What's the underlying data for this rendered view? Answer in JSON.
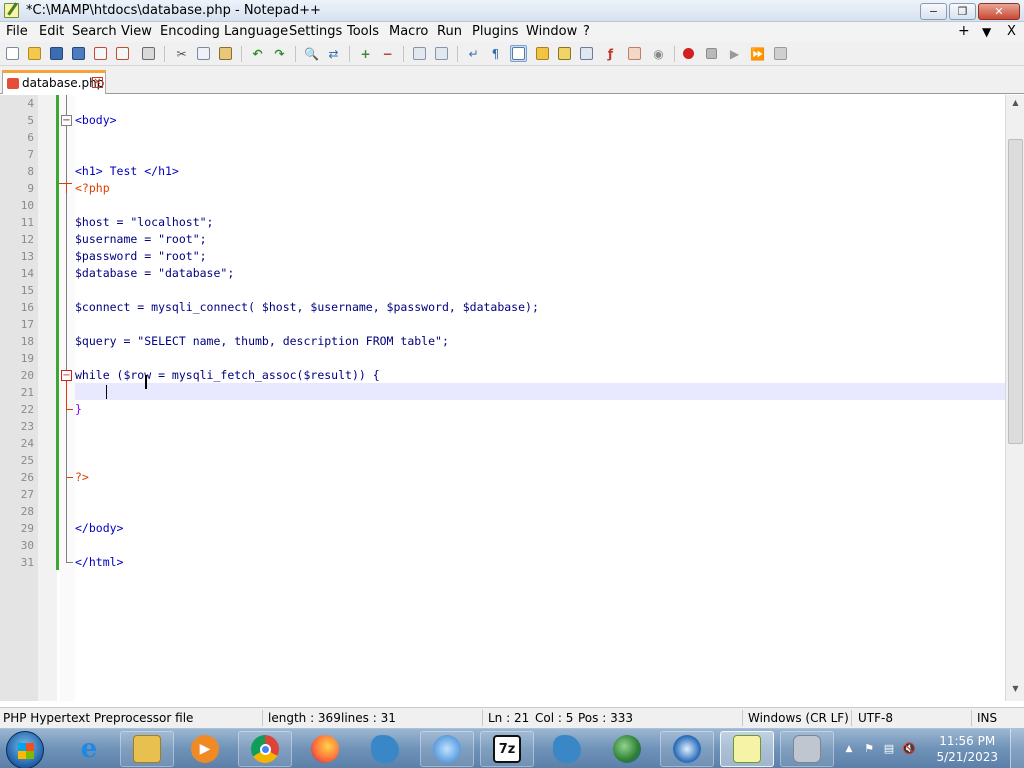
{
  "window": {
    "title": "*C:\\MAMP\\htdocs\\database.php - Notepad++",
    "controls": {
      "minimize": "−",
      "maximize": "❐",
      "close": "✕"
    }
  },
  "menu": {
    "items": [
      "File",
      "Edit",
      "Search",
      "View",
      "Encoding",
      "Language",
      "Settings",
      "Tools",
      "Macro",
      "Run",
      "Plugins",
      "Window",
      "?"
    ],
    "right": {
      "add": "+",
      "dropdown": "▼",
      "close": "X"
    }
  },
  "toolbar": {
    "icons": [
      "new-file",
      "open-file",
      "save",
      "save-all",
      "close",
      "close-all",
      "print",
      "cut",
      "copy",
      "paste",
      "undo",
      "redo",
      "find",
      "replace",
      "zoom-in",
      "zoom-out",
      "sync-vertical",
      "sync-horizontal",
      "word-wrap",
      "show-all-chars",
      "indent-guide",
      "user-defined-language",
      "document-map",
      "function-list",
      "folder-as-workspace",
      "monitoring",
      "record-macro",
      "stop-recording",
      "playback-macro",
      "run-macro-multiple",
      "save-macro"
    ]
  },
  "tab": {
    "label": "database.php",
    "close": "✕"
  },
  "editor": {
    "lines": [
      {
        "n": "4",
        "t": ""
      },
      {
        "n": "5",
        "t": "<body>"
      },
      {
        "n": "6",
        "t": ""
      },
      {
        "n": "7",
        "t": ""
      },
      {
        "n": "8",
        "t": "<h1> Test </h1>"
      },
      {
        "n": "9",
        "t": "<?php"
      },
      {
        "n": "10",
        "t": ""
      },
      {
        "n": "11",
        "t": "$host = \"localhost\";"
      },
      {
        "n": "12",
        "t": "$username = \"root\";"
      },
      {
        "n": "13",
        "t": "$password = \"root\";"
      },
      {
        "n": "14",
        "t": "$database = \"database\";"
      },
      {
        "n": "15",
        "t": ""
      },
      {
        "n": "16",
        "t": "$connect = mysqli_connect( $host, $username, $password, $database);"
      },
      {
        "n": "17",
        "t": ""
      },
      {
        "n": "18",
        "t": "$query = \"SELECT name, thumb, description FROM table\";"
      },
      {
        "n": "19",
        "t": ""
      },
      {
        "n": "20",
        "t": "while ($row = mysqli_fetch_assoc($result)) {"
      },
      {
        "n": "21",
        "t": ""
      },
      {
        "n": "22",
        "t": "}"
      },
      {
        "n": "23",
        "t": ""
      },
      {
        "n": "24",
        "t": ""
      },
      {
        "n": "25",
        "t": ""
      },
      {
        "n": "26",
        "t": "?>"
      },
      {
        "n": "27",
        "t": ""
      },
      {
        "n": "28",
        "t": ""
      },
      {
        "n": "29",
        "t": "</body>"
      },
      {
        "n": "30",
        "t": ""
      },
      {
        "n": "31",
        "t": "</html>"
      }
    ],
    "current_line": "21"
  },
  "status": {
    "file_type": "PHP Hypertext Preprocessor file",
    "length": "length : 369",
    "lines": "lines : 31",
    "ln": "Ln : 21",
    "col": "Col : 5",
    "pos": "Pos : 333",
    "eol": "Windows (CR LF)",
    "encoding": "UTF-8",
    "mode": "INS"
  },
  "taskbar": {
    "apps": [
      {
        "name": "internet-explorer",
        "glyph": "e",
        "color": "#1e88e5"
      },
      {
        "name": "file-explorer",
        "glyph": "",
        "color": "#e8c050"
      },
      {
        "name": "media-player",
        "glyph": "▶",
        "color": "#f08a24"
      },
      {
        "name": "chrome",
        "glyph": "",
        "color": "#4285f4"
      },
      {
        "name": "firefox",
        "glyph": "",
        "color": "#ff7139"
      },
      {
        "name": "mysql-workbench",
        "glyph": "",
        "color": "#3a87c8"
      },
      {
        "name": "network-tool",
        "glyph": "",
        "color": "#2f7fd0"
      },
      {
        "name": "7zip",
        "glyph": "7z",
        "color": "#111111"
      },
      {
        "name": "mysql",
        "glyph": "",
        "color": "#3a87c8"
      },
      {
        "name": "globe-app",
        "glyph": "",
        "color": "#4caf50"
      },
      {
        "name": "thunderbird",
        "glyph": "",
        "color": "#2a6ebb"
      },
      {
        "name": "notepad-plus-plus",
        "glyph": "",
        "color": "#8bc34a"
      },
      {
        "name": "mamp",
        "glyph": "",
        "color": "#c0c6d0"
      }
    ],
    "clock_time": "11:56 PM",
    "clock_date": "5/21/2023"
  }
}
